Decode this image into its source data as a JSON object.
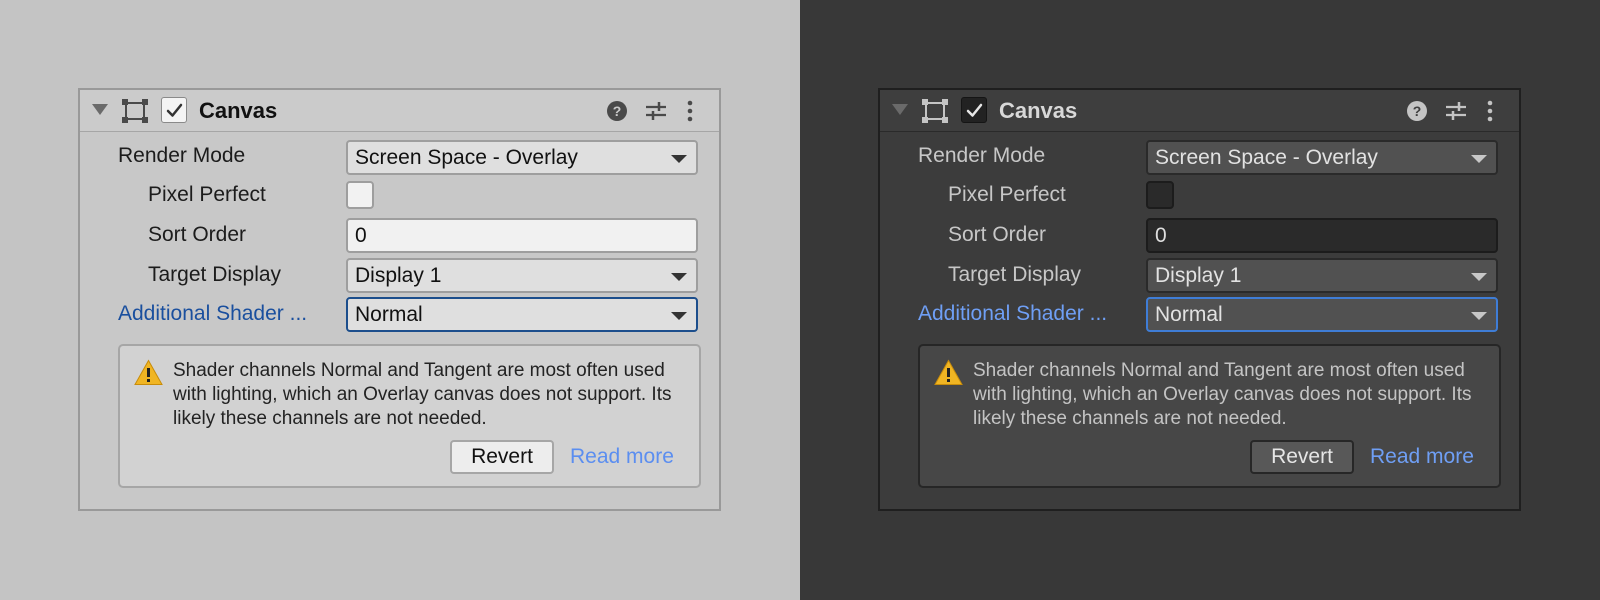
{
  "themes": [
    {
      "key": "light",
      "icon_color": "#4a4a4a",
      "check_color": "#333333",
      "warning_color": "#f0b523"
    },
    {
      "key": "dark",
      "icon_color": "#c4c4c4",
      "check_color": "#e6e6e6",
      "warning_color": "#f0b523"
    }
  ],
  "component": {
    "title": "Canvas",
    "enabled": true,
    "expanded": true,
    "header_icons": [
      "help-icon",
      "preset-icon",
      "context-menu-icon"
    ],
    "component_icon": "rect-transform-icon"
  },
  "fields": {
    "render_mode": {
      "label": "Render Mode",
      "value": "Screen Space - Overlay"
    },
    "pixel_perfect": {
      "label": "Pixel Perfect",
      "checked": false
    },
    "sort_order": {
      "label": "Sort Order",
      "value": "0"
    },
    "target_display": {
      "label": "Target Display",
      "value": "Display 1"
    },
    "additional_shader": {
      "label": "Additional Shader ...",
      "value": "Normal",
      "modified": true
    }
  },
  "helpbox": {
    "type": "warning",
    "icon": "warning-icon",
    "message": "Shader channels Normal and Tangent are most often used with lighting, which an Overlay canvas does not support. Its likely these channels are not needed.",
    "revert_label": "Revert",
    "read_more_label": "Read more"
  }
}
